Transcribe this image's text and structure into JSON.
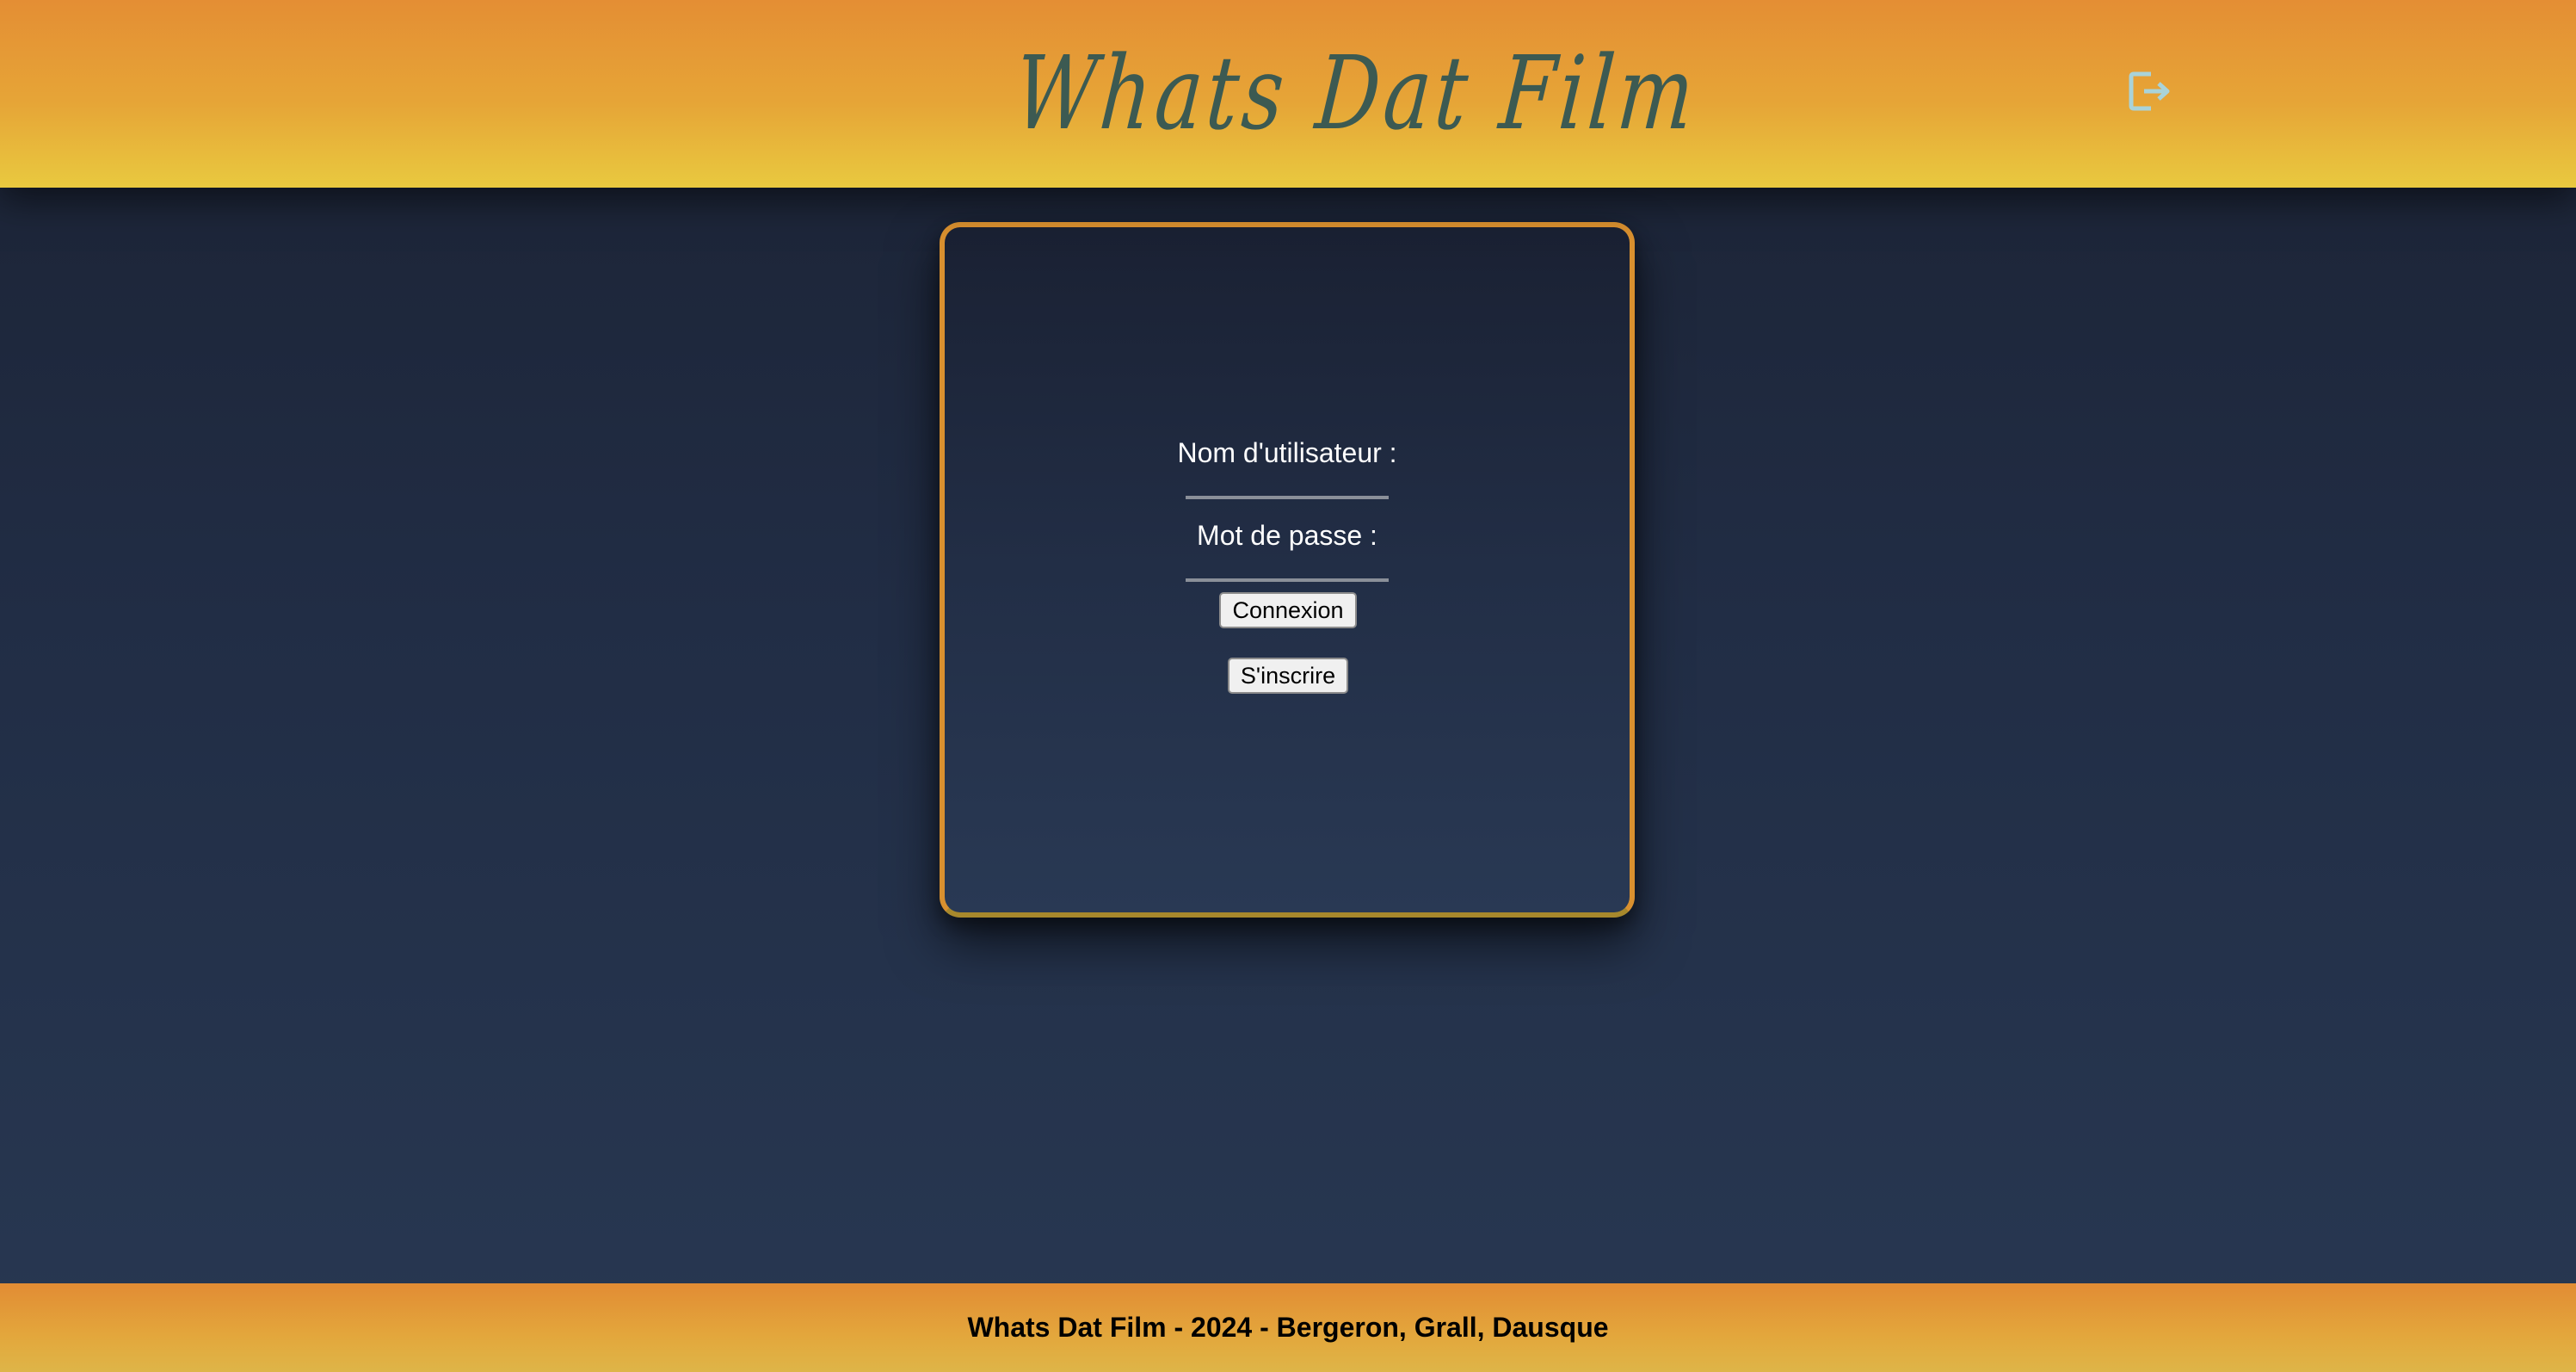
{
  "header": {
    "logo_text": "Whats Dat Film",
    "logout_icon": "logout-icon",
    "colors": {
      "gradient_top": "#e48e34",
      "gradient_bottom": "#e9c93f",
      "logo": "#3c5a52",
      "icon": "#a9d3d9"
    }
  },
  "login": {
    "username_label": "Nom d'utilisateur :",
    "username_value": "",
    "password_label": "Mot de passe :",
    "password_value": "",
    "connexion_button": "Connexion",
    "signup_button": "S'inscrire",
    "colors": {
      "border": "#d9902f",
      "background": "#222e46"
    }
  },
  "footer": {
    "text": "Whats Dat Film - 2024 - Bergeron, Grall, Dausque"
  }
}
